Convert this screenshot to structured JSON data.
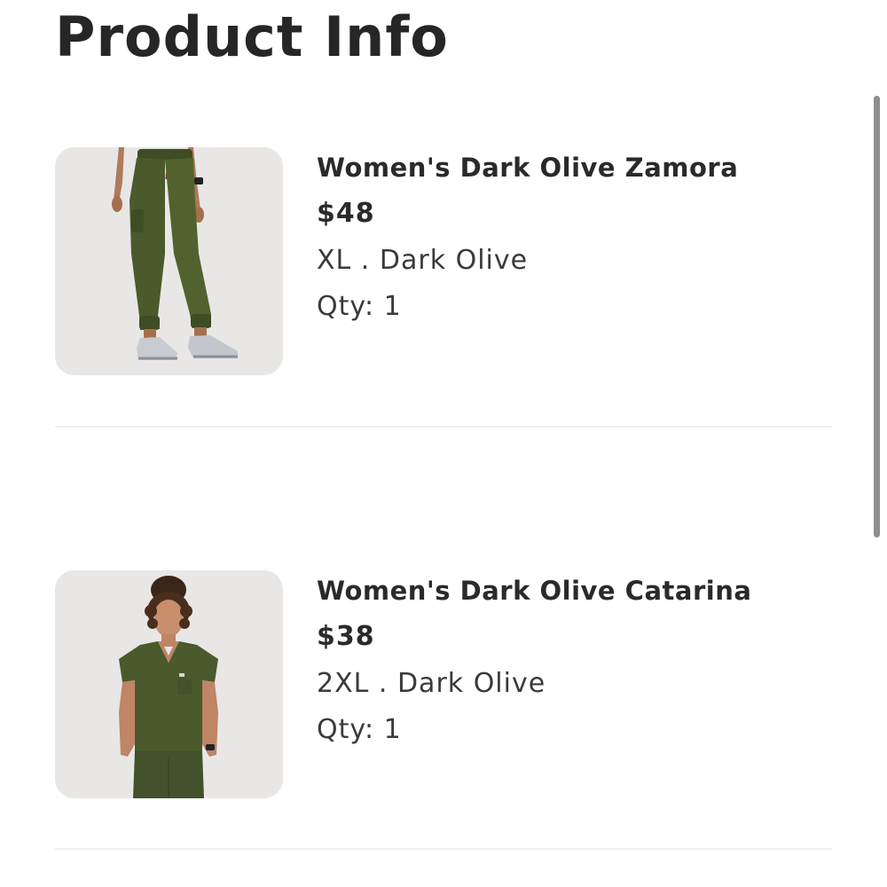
{
  "page": {
    "title": "Product Info"
  },
  "products": [
    {
      "name": "Women's Dark Olive Zamora",
      "price": "$48",
      "variant": "XL . Dark Olive",
      "qty": "Qty: 1",
      "image_subject": "jogger-scrub-pants",
      "color": "#4a5a2c"
    },
    {
      "name": "Women's Dark Olive Catarina",
      "price": "$38",
      "variant": "2XL . Dark Olive",
      "qty": "Qty: 1",
      "image_subject": "v-neck-scrub-top",
      "color": "#4a5a2c"
    }
  ],
  "colors": {
    "thumb_background": "#e8e7e5",
    "divider": "#efefef",
    "scrollbar": "#8e8e8e"
  }
}
